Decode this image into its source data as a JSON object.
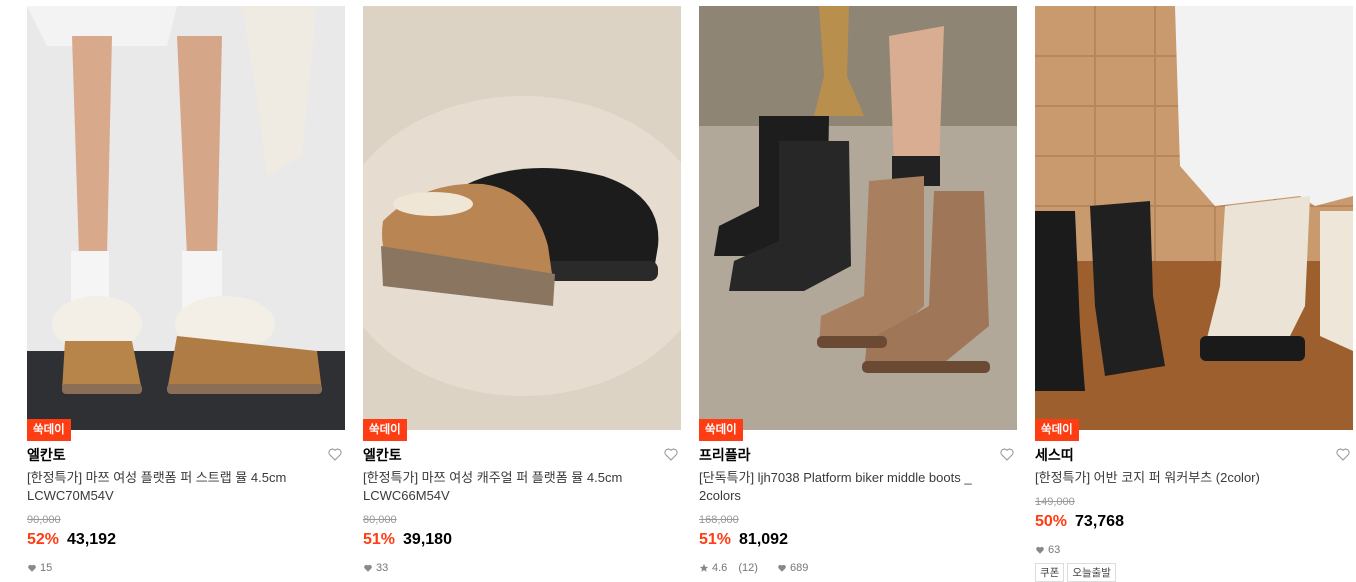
{
  "products": [
    {
      "badge": "쑥데이",
      "brand": "엘칸토",
      "title": "[한정특가] 마쯔 여성 플랫폼 퍼 스트랩 뮬 4.5cm LCWC70M54V",
      "original_price": "90,000",
      "discount": "52%",
      "price": "43,192",
      "likes": "15",
      "image_desc": "tan-fur-platform-mules-on-model"
    },
    {
      "badge": "쑥데이",
      "brand": "엘칸토",
      "title": "[한정특가] 마쯔 여성 캐주얼 퍼 플랫폼 뮬 4.5cm LCWC66M54V",
      "original_price": "80,000",
      "discount": "51%",
      "price": "39,180",
      "likes": "33",
      "image_desc": "tan-and-black-suede-platform-mules"
    },
    {
      "badge": "쑥데이",
      "brand": "프리플라",
      "title": "[단독특가] ljh7038 Platform biker middle boots _ 2colors",
      "original_price": "168,000",
      "discount": "51%",
      "price": "81,092",
      "rating": "4.6",
      "reviews": "(12)",
      "likes": "689",
      "image_desc": "black-and-brown-biker-boots"
    },
    {
      "badge": "쑥데이",
      "brand": "세스띠",
      "title": "[한정특가] 어반 코지 퍼 워커부츠 (2color)",
      "original_price": "149,000",
      "discount": "50%",
      "price": "73,768",
      "likes": "63",
      "tags": [
        "쿠폰",
        "오늘출발"
      ],
      "image_desc": "black-and-cream-fur-walker-boots"
    }
  ],
  "colors": {
    "accent": "#ff3d13",
    "muted": "#999999"
  }
}
